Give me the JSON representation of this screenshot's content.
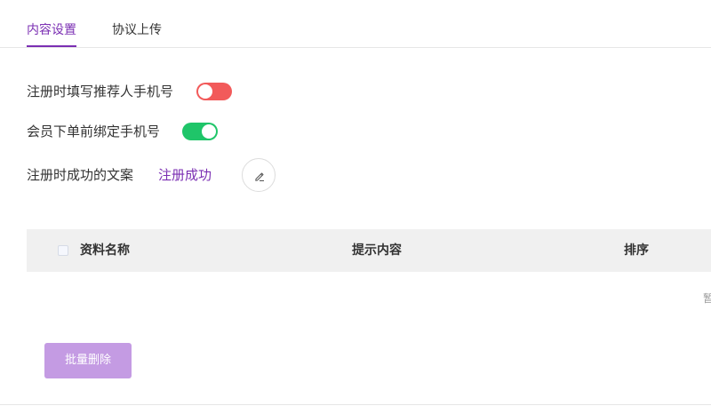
{
  "tabs": [
    {
      "label": "内容设置",
      "active": true
    },
    {
      "label": "协议上传",
      "active": false
    }
  ],
  "settings": {
    "referrer_phone": {
      "label": "注册时填写推荐人手机号",
      "enabled": false,
      "color": "#f25a5a"
    },
    "bind_phone": {
      "label": "会员下单前绑定手机号",
      "enabled": true,
      "color": "#1fc569"
    },
    "success_copy": {
      "label": "注册时成功的文案",
      "value": "注册成功"
    }
  },
  "table": {
    "columns": [
      "资料名称",
      "提示内容",
      "排序"
    ],
    "empty_text": "暂"
  },
  "actions": {
    "batch_delete_label": "批量删除"
  },
  "colors": {
    "accent": "#7b2fb3",
    "batch_delete_bg": "#c49be3"
  }
}
